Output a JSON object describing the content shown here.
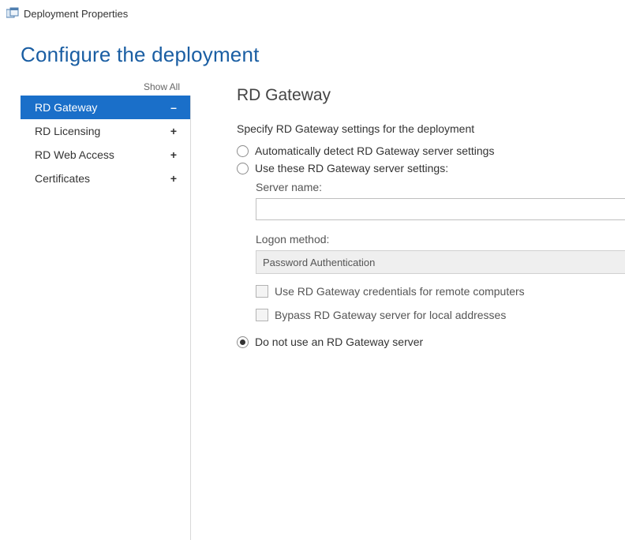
{
  "window": {
    "title": "Deployment Properties"
  },
  "header": {
    "title": "Configure the deployment"
  },
  "sidebar": {
    "show_all": "Show All",
    "items": [
      {
        "label": "RD Gateway",
        "expander": "minus",
        "selected": true
      },
      {
        "label": "RD Licensing",
        "expander": "plus",
        "selected": false
      },
      {
        "label": "RD Web Access",
        "expander": "plus",
        "selected": false
      },
      {
        "label": "Certificates",
        "expander": "plus",
        "selected": false
      }
    ]
  },
  "panel": {
    "heading": "RD Gateway",
    "lead": "Specify RD Gateway settings for the deployment",
    "options": {
      "auto": {
        "label": "Automatically detect RD Gateway server settings",
        "checked": false
      },
      "usethese": {
        "label": "Use these RD Gateway server settings:",
        "checked": false,
        "server_name_label": "Server name:",
        "server_name_value": "",
        "logon_method_label": "Logon method:",
        "logon_method_value": "Password Authentication",
        "cb_credentials": {
          "label": "Use RD Gateway credentials for remote computers",
          "checked": false
        },
        "cb_bypass": {
          "label": "Bypass RD Gateway server for local addresses",
          "checked": false
        }
      },
      "none": {
        "label": "Do not use an RD Gateway server",
        "checked": true
      }
    }
  }
}
